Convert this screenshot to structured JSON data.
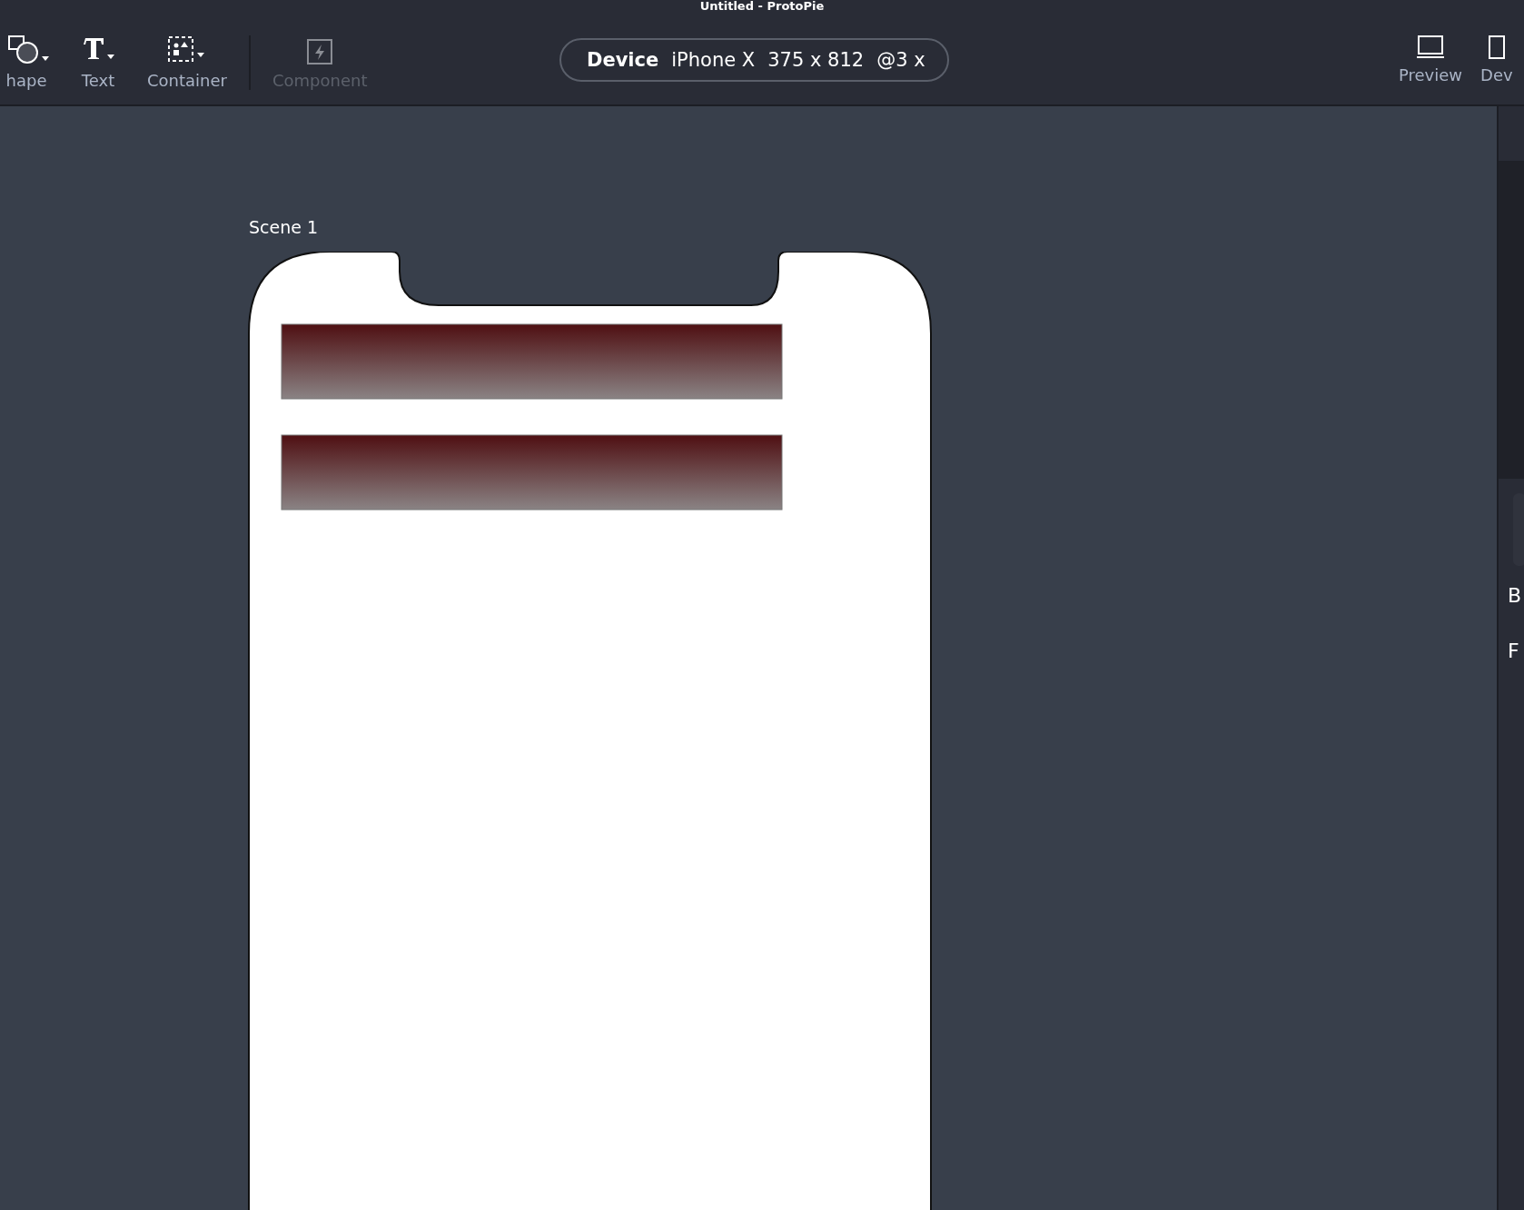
{
  "window": {
    "title": "Untitled - ProtoPie"
  },
  "toolbar": {
    "tools": [
      {
        "label": "hape",
        "kind": "shape",
        "disabled": false
      },
      {
        "label": "Text",
        "kind": "text",
        "disabled": false
      },
      {
        "label": "Container",
        "kind": "container",
        "disabled": false
      },
      {
        "label": "Component",
        "kind": "component",
        "disabled": true
      }
    ],
    "device": {
      "label": "Device",
      "model": "iPhone X",
      "size": "375 x 812",
      "scale": "@3 x"
    },
    "right_tools": [
      {
        "label": "Preview",
        "kind": "preview"
      },
      {
        "label": "Dev",
        "kind": "device"
      }
    ]
  },
  "canvas": {
    "scene_title": "Scene 1"
  },
  "inspector": {
    "labels": [
      "B",
      "F"
    ]
  }
}
